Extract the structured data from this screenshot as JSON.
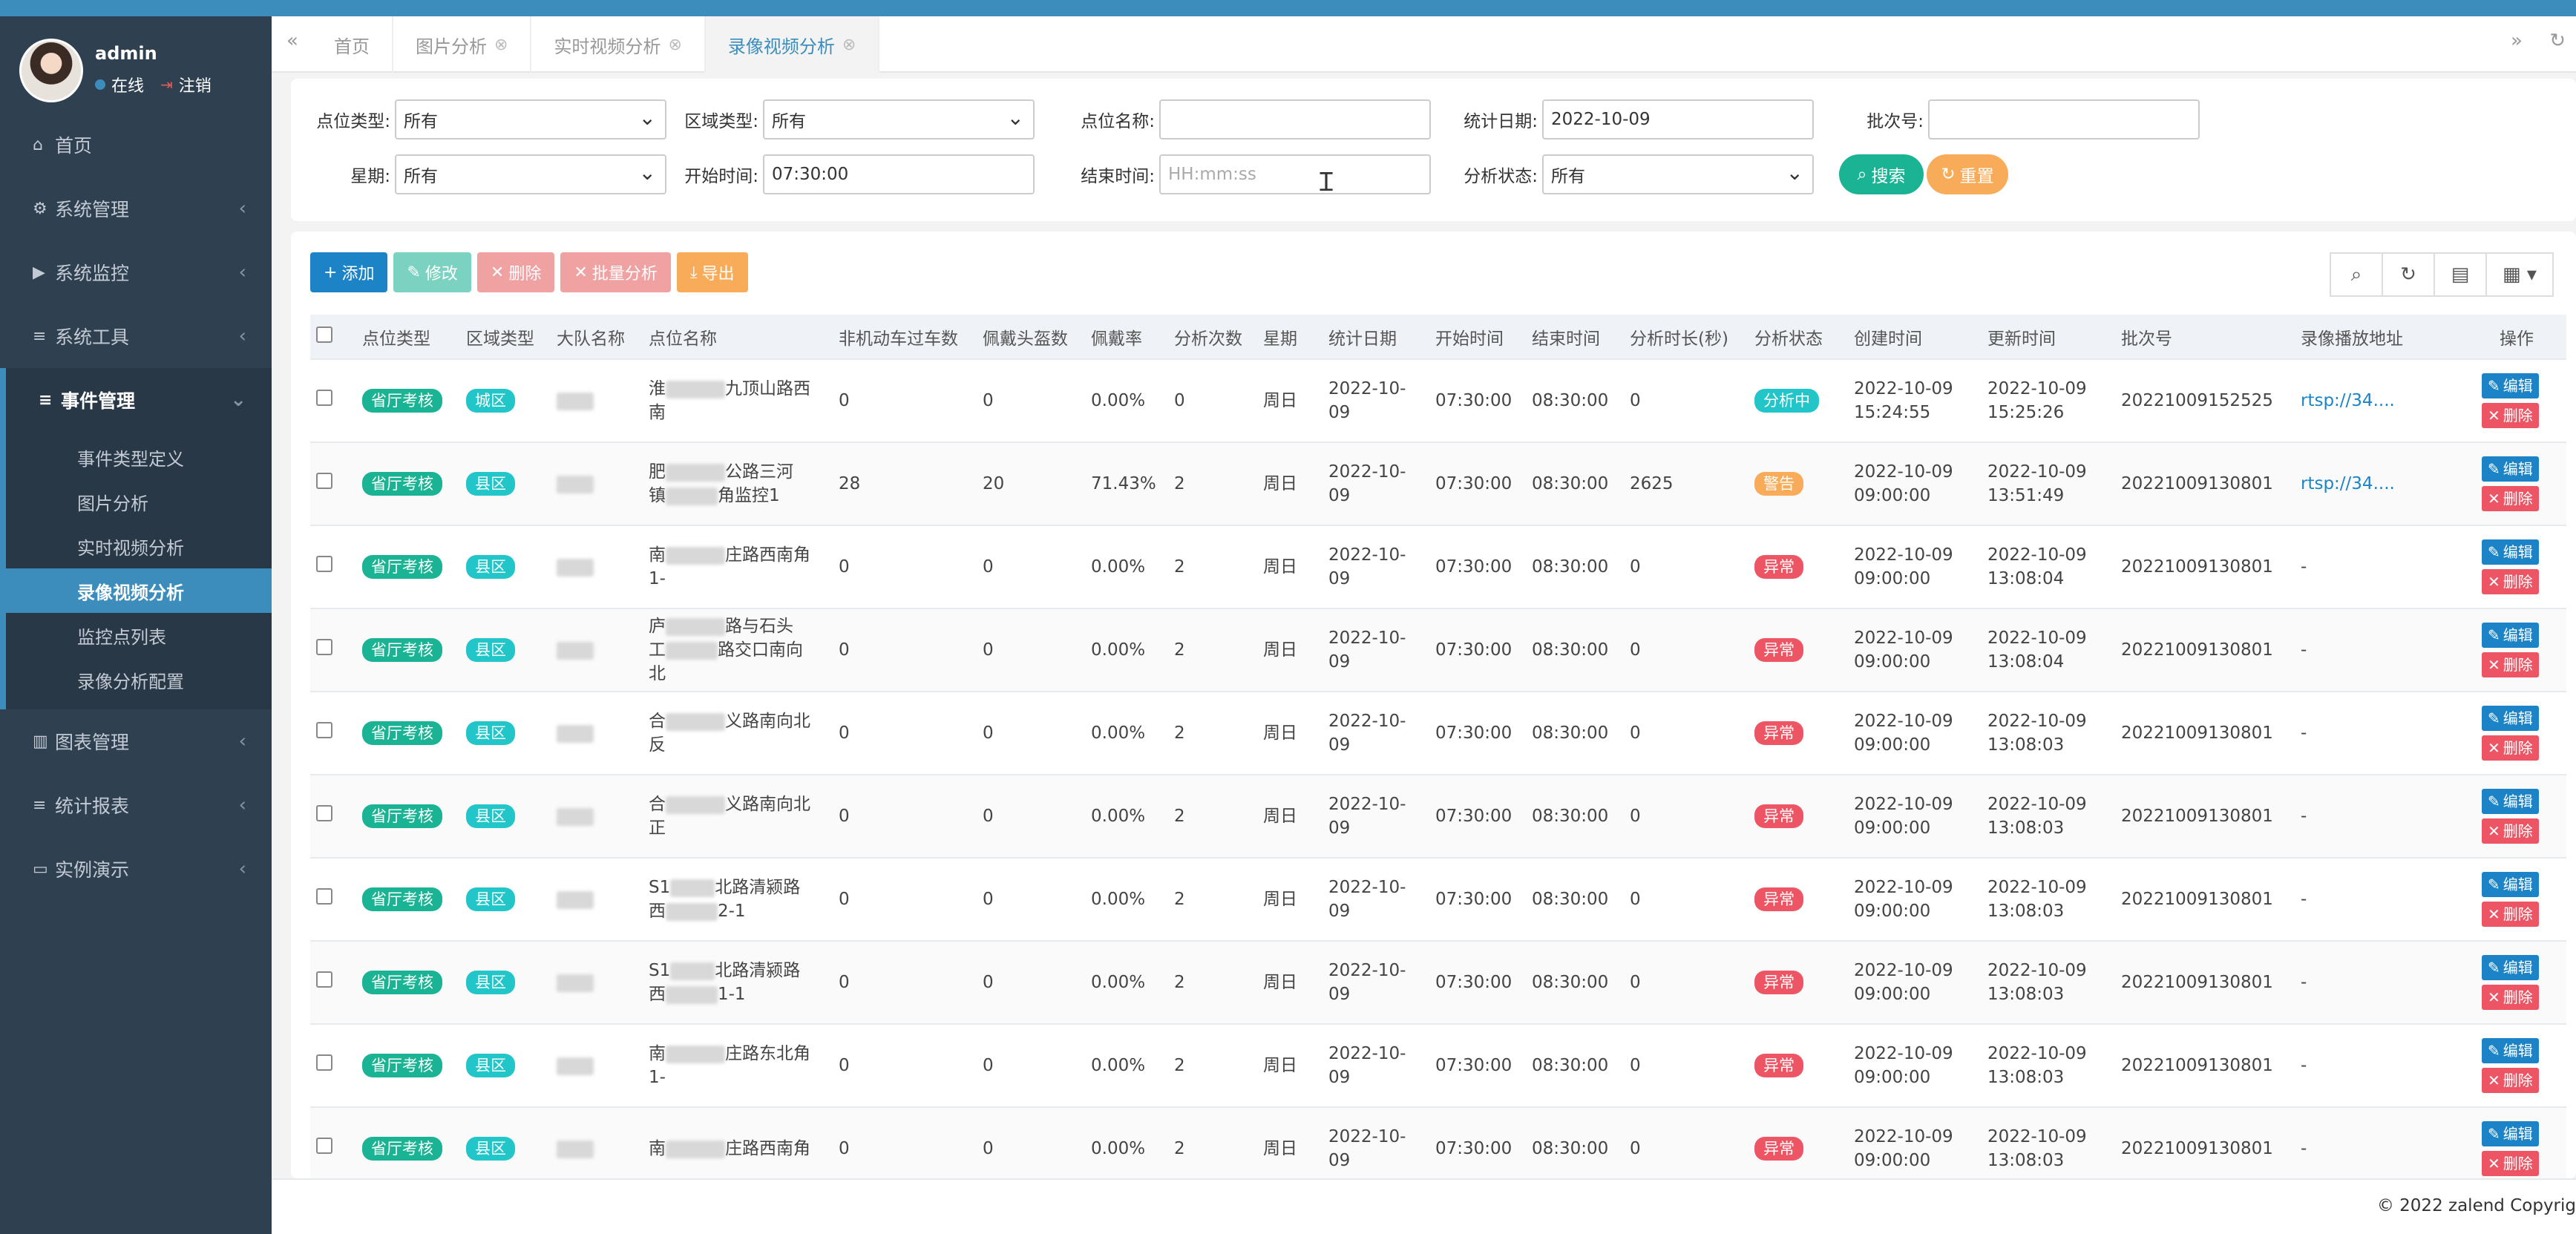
{
  "user": {
    "name": "admin",
    "status": "在线",
    "logout": "注销"
  },
  "menu": [
    {
      "label": "首页",
      "icon": "home-icon",
      "glyph": "⌂",
      "caret": ""
    },
    {
      "label": "系统管理",
      "icon": "gear-icon",
      "glyph": "⚙",
      "caret": "‹"
    },
    {
      "label": "系统监控",
      "icon": "video-camera-icon",
      "glyph": "▶",
      "caret": "‹"
    },
    {
      "label": "系统工具",
      "icon": "bars-icon",
      "glyph": "≡",
      "caret": "‹"
    },
    {
      "label": "事件管理",
      "icon": "bars-icon",
      "glyph": "≡",
      "caret": "⌄"
    },
    {
      "label": "图表管理",
      "icon": "bar-chart-icon",
      "glyph": "▥",
      "caret": "‹"
    },
    {
      "label": "统计报表",
      "icon": "bars-icon",
      "glyph": "≡",
      "caret": "‹"
    },
    {
      "label": "实例演示",
      "icon": "desktop-icon",
      "glyph": "▭",
      "caret": "‹"
    }
  ],
  "submenu": [
    "事件类型定义",
    "图片分析",
    "实时视频分析",
    "录像视频分析",
    "监控点列表",
    "录像分析配置"
  ],
  "tabs": [
    {
      "label": "首页"
    },
    {
      "label": "图片分析"
    },
    {
      "label": "实时视频分析"
    },
    {
      "label": "录像视频分析"
    }
  ],
  "search": {
    "point_type_label": "点位类型:",
    "point_type_value": "所有",
    "area_type_label": "区域类型:",
    "area_type_value": "所有",
    "point_name_label": "点位名称:",
    "point_name_value": "",
    "stat_date_label": "统计日期:",
    "stat_date_value": "2022-10-09",
    "batch_label": "批次号:",
    "batch_value": "",
    "week_label": "星期:",
    "week_value": "所有",
    "start_label": "开始时间:",
    "start_value": "07:30:00",
    "end_label": "结束时间:",
    "end_placeholder": "HH:mm:ss",
    "status_label": "分析状态:",
    "status_value": "所有",
    "search_btn": "搜索",
    "reset_btn": "重置"
  },
  "toolbar": {
    "add": "添加",
    "edit": "修改",
    "delete": "删除",
    "batch": "批量分析",
    "export": "导出"
  },
  "columns": [
    "点位类型",
    "区域类型",
    "大队名称",
    "点位名称",
    "非机动车过车数",
    "佩戴头盔数",
    "佩戴率",
    "分析次数",
    "星期",
    "统计日期",
    "开始时间",
    "结束时间",
    "分析时长(秒)",
    "分析状态",
    "创建时间",
    "更新时间",
    "批次号",
    "录像播放地址",
    "操作"
  ],
  "rows": [
    {
      "ptype": "省厅考核",
      "atype": "城区",
      "name1": "淮",
      "name2": "九顶山路西",
      "name3": "南",
      "vehicles": "0",
      "helmets": "0",
      "rate": "0.00%",
      "count": "0",
      "week": "周日",
      "date1": "2022-10-",
      "date2": "09",
      "start": "07:30:00",
      "end": "08:30:00",
      "duration": "0",
      "status": "分析中",
      "status_color": "teal",
      "created1": "2022-10-09",
      "created2": "15:24:55",
      "updated1": "2022-10-09",
      "updated2": "15:25:26",
      "batch": "20221009152525",
      "url": "rtsp://34...."
    },
    {
      "ptype": "省厅考核",
      "atype": "县区",
      "name1": "肥",
      "name2": "公路三河",
      "name3": "镇",
      "name4": "角监控1",
      "vehicles": "28",
      "helmets": "20",
      "rate": "71.43%",
      "count": "2",
      "week": "周日",
      "date1": "2022-10-",
      "date2": "09",
      "start": "07:30:00",
      "end": "08:30:00",
      "duration": "2625",
      "status": "警告",
      "status_color": "orange",
      "created1": "2022-10-09",
      "created2": "09:00:00",
      "updated1": "2022-10-09",
      "updated2": "13:51:49",
      "batch": "20221009130801",
      "url": "rtsp://34...."
    },
    {
      "ptype": "省厅考核",
      "atype": "县区",
      "name1": "南",
      "name2": "庄路西南角",
      "name3": "1-",
      "vehicles": "0",
      "helmets": "0",
      "rate": "0.00%",
      "count": "2",
      "week": "周日",
      "date1": "2022-10-",
      "date2": "09",
      "start": "07:30:00",
      "end": "08:30:00",
      "duration": "0",
      "status": "异常",
      "status_color": "red",
      "created1": "2022-10-09",
      "created2": "09:00:00",
      "updated1": "2022-10-09",
      "updated2": "13:08:04",
      "batch": "20221009130801",
      "url": "-"
    },
    {
      "ptype": "省厅考核",
      "atype": "县区",
      "name1": "庐",
      "name2": "路与石头",
      "name3": "工",
      "name4": "路交口南向",
      "name5": "北",
      "vehicles": "0",
      "helmets": "0",
      "rate": "0.00%",
      "count": "2",
      "week": "周日",
      "date1": "2022-10-",
      "date2": "09",
      "start": "07:30:00",
      "end": "08:30:00",
      "duration": "0",
      "status": "异常",
      "status_color": "red",
      "created1": "2022-10-09",
      "created2": "09:00:00",
      "updated1": "2022-10-09",
      "updated2": "13:08:04",
      "batch": "20221009130801",
      "url": "-"
    },
    {
      "ptype": "省厅考核",
      "atype": "县区",
      "name1": "合",
      "name2": "义路南向北",
      "name3": "反",
      "vehicles": "0",
      "helmets": "0",
      "rate": "0.00%",
      "count": "2",
      "week": "周日",
      "date1": "2022-10-",
      "date2": "09",
      "start": "07:30:00",
      "end": "08:30:00",
      "duration": "0",
      "status": "异常",
      "status_color": "red",
      "created1": "2022-10-09",
      "created2": "09:00:00",
      "updated1": "2022-10-09",
      "updated2": "13:08:03",
      "batch": "20221009130801",
      "url": "-"
    },
    {
      "ptype": "省厅考核",
      "atype": "县区",
      "name1": "合",
      "name2": "义路南向北",
      "name3": "正",
      "vehicles": "0",
      "helmets": "0",
      "rate": "0.00%",
      "count": "2",
      "week": "周日",
      "date1": "2022-10-",
      "date2": "09",
      "start": "07:30:00",
      "end": "08:30:00",
      "duration": "0",
      "status": "异常",
      "status_color": "red",
      "created1": "2022-10-09",
      "created2": "09:00:00",
      "updated1": "2022-10-09",
      "updated2": "13:08:03",
      "batch": "20221009130801",
      "url": "-"
    },
    {
      "ptype": "省厅考核",
      "atype": "县区",
      "name1": "S1",
      "name2": "北路清颍路",
      "name3": "西",
      "name4": "2-1",
      "vehicles": "0",
      "helmets": "0",
      "rate": "0.00%",
      "count": "2",
      "week": "周日",
      "date1": "2022-10-",
      "date2": "09",
      "start": "07:30:00",
      "end": "08:30:00",
      "duration": "0",
      "status": "异常",
      "status_color": "red",
      "created1": "2022-10-09",
      "created2": "09:00:00",
      "updated1": "2022-10-09",
      "updated2": "13:08:03",
      "batch": "20221009130801",
      "url": "-"
    },
    {
      "ptype": "省厅考核",
      "atype": "县区",
      "name1": "S1",
      "name2": "北路清颍路",
      "name3": "西",
      "name4": "1-1",
      "vehicles": "0",
      "helmets": "0",
      "rate": "0.00%",
      "count": "2",
      "week": "周日",
      "date1": "2022-10-",
      "date2": "09",
      "start": "07:30:00",
      "end": "08:30:00",
      "duration": "0",
      "status": "异常",
      "status_color": "red",
      "created1": "2022-10-09",
      "created2": "09:00:00",
      "updated1": "2022-10-09",
      "updated2": "13:08:03",
      "batch": "20221009130801",
      "url": "-"
    },
    {
      "ptype": "省厅考核",
      "atype": "县区",
      "name1": "南",
      "name2": "庄路东北角",
      "name3": "1-",
      "vehicles": "0",
      "helmets": "0",
      "rate": "0.00%",
      "count": "2",
      "week": "周日",
      "date1": "2022-10-",
      "date2": "09",
      "start": "07:30:00",
      "end": "08:30:00",
      "duration": "0",
      "status": "异常",
      "status_color": "red",
      "created1": "2022-10-09",
      "created2": "09:00:00",
      "updated1": "2022-10-09",
      "updated2": "13:08:03",
      "batch": "20221009130801",
      "url": "-"
    },
    {
      "ptype": "省厅考核",
      "atype": "县区",
      "name1": "南",
      "name2": "庄路西南角",
      "name3": "",
      "vehicles": "0",
      "helmets": "0",
      "rate": "0.00%",
      "count": "2",
      "week": "周日",
      "date1": "2022-10-",
      "date2": "09",
      "start": "07:30:00",
      "end": "08:30:00",
      "duration": "0",
      "status": "异常",
      "status_color": "red",
      "created1": "2022-10-09",
      "created2": "09:00:00",
      "updated1": "2022-10-09",
      "updated2": "13:08:03",
      "batch": "20221009130801",
      "url": "-"
    }
  ],
  "actions": {
    "edit": "编辑",
    "delete": "删除"
  },
  "footer": {
    "copyright": "© 2022 zalend Copyrig"
  },
  "colors": {
    "sidebar": "#2f4050",
    "primary": "#1c84c6",
    "success": "#1ab394",
    "warning": "#f8ac59",
    "danger": "#ed5565",
    "info": "#23c6c8",
    "active": "#3c8dbc"
  }
}
